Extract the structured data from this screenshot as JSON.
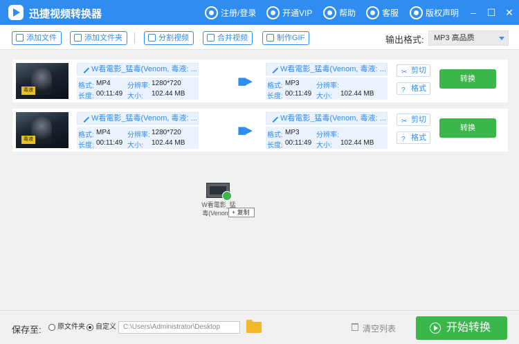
{
  "app": {
    "title": "迅捷视频转换器"
  },
  "titlebar": {
    "register_login": "注册/登录",
    "vip": "开通VIP",
    "help": "帮助",
    "service": "客服",
    "copyright": "版权声明",
    "minimize": "–",
    "maximize": "☐",
    "close": "✕"
  },
  "toolbar": {
    "add_file": "添加文件",
    "add_folder": "添加文件夹",
    "split_video": "分割视频",
    "merge_video": "合并视频",
    "make_gif": "制作GIF",
    "output_format_label": "输出格式:",
    "output_format_value": "MP3  高品质"
  },
  "labels": {
    "format": "格式:",
    "resolution": "分辨率:",
    "duration": "长度:",
    "size": "大小:",
    "cut": "剪切",
    "format_btn": "格式",
    "convert": "转换"
  },
  "rows": [
    {
      "thumb_tag": "毒液",
      "source_name": "W看電影_猛毒(Venom, 毒液: ...",
      "source_format": "MP4",
      "source_resolution": "1280*720",
      "source_duration": "00:11:49",
      "source_size": "102.44 MB",
      "target_name": "W看電影_猛毒(Venom, 毒液: ...",
      "target_format": "MP3",
      "target_resolution": "",
      "target_duration": "00:11:49",
      "target_size": "102.44 MB"
    },
    {
      "thumb_tag": "毒液",
      "source_name": "W看電影_猛毒(Venom, 毒液: ...",
      "source_format": "MP4",
      "source_resolution": "1280*720",
      "source_duration": "00:11:49",
      "source_size": "102.44 MB",
      "target_name": "W看電影_猛毒(Venom, 毒液: ...",
      "target_format": "MP3",
      "target_resolution": "",
      "target_duration": "00:11:49",
      "target_size": "102.44 MB"
    }
  ],
  "drag": {
    "file_name": "W看電影_猛毒(Venom...",
    "copy_tip": "复制"
  },
  "footer": {
    "save_to": "保存至:",
    "original_folder": "原文件夹",
    "custom": "自定义",
    "path": "C:\\Users\\Administrator\\Desktop",
    "clear_list": "清空列表",
    "start_convert": "开始转换"
  },
  "colors": {
    "accent": "#2f8cf0",
    "green": "#3ab64b"
  }
}
